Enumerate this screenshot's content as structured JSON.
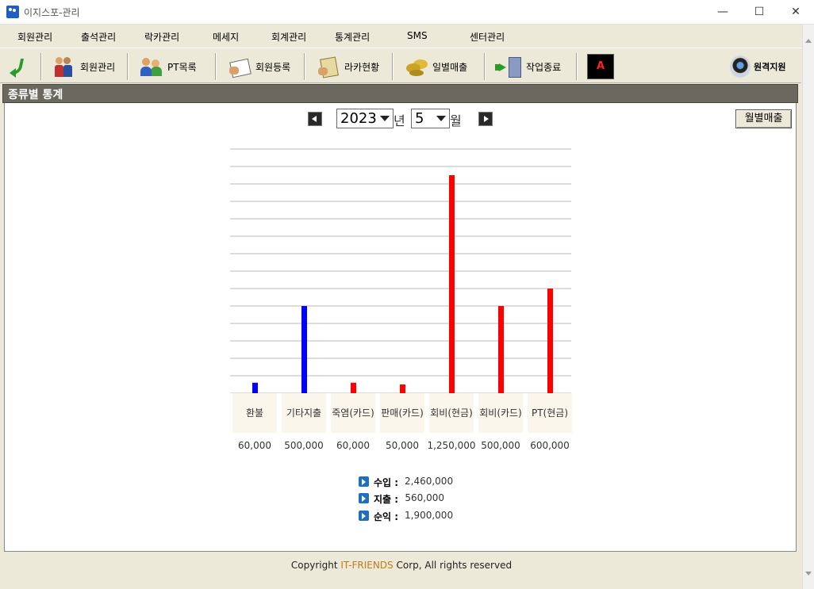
{
  "window": {
    "title": "이지스포-관리",
    "min_label": "—",
    "max_label": "☐",
    "close_label": "✕"
  },
  "menu": [
    "회원관리",
    "출석관리",
    "락카관리",
    "메세지",
    "회계관리",
    "통계관리",
    "SMS",
    "센터관리"
  ],
  "toolbar": {
    "members_label": "회원관리",
    "pt_label": "PT목록",
    "register_label": "회원등록",
    "locker_label": "라카현황",
    "daily_sales_label": "일별매출",
    "exit_label": "작업종료",
    "a_label": "A",
    "remote_label": "원격지원"
  },
  "panel": {
    "title": "종류별 통계"
  },
  "period": {
    "year": "2023",
    "year_unit": "년",
    "month": "5",
    "month_unit": "월"
  },
  "monthly_button": "월별매출",
  "chart_data": {
    "type": "bar",
    "categories": [
      "환불",
      "기타지출",
      "죽염(카드)",
      "판매(카드)",
      "회비(현금)",
      "회비(카드)",
      "PT(현금)"
    ],
    "values": [
      60000,
      500000,
      60000,
      50000,
      1250000,
      500000,
      600000
    ],
    "value_labels": [
      "60,000",
      "500,000",
      "60,000",
      "50,000",
      "1,250,000",
      "500,000",
      "600,000"
    ],
    "bar_colors": [
      "#0000ff",
      "#0000ff",
      "#ff0000",
      "#ff0000",
      "#ff0000",
      "#ff0000",
      "#ff0000"
    ],
    "ylim": [
      0,
      1400000
    ],
    "grid": true
  },
  "summary": {
    "income_label": "수입 :",
    "income_value": "2,460,000",
    "expense_label": "지출 :",
    "expense_value": "560,000",
    "net_label": "순익 :",
    "net_value": "1,900,000"
  },
  "footer": {
    "prefix": "Copyright ",
    "brand": "IT-FRIENDS",
    "suffix": " Corp, All rights reserved"
  }
}
